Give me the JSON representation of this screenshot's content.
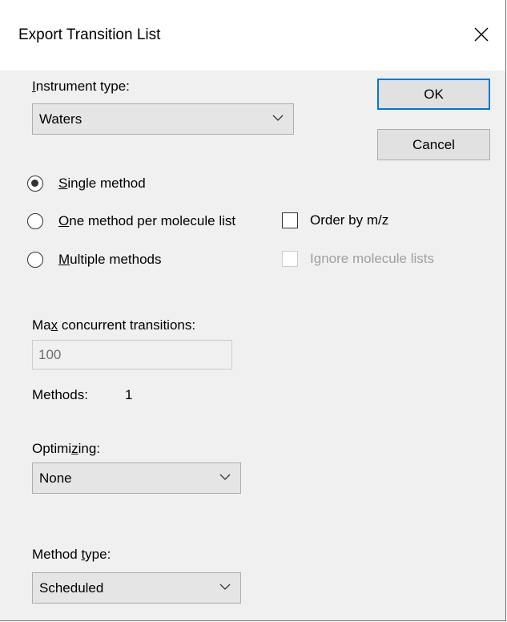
{
  "window": {
    "title": "Export Transition List",
    "close_icon": "close-x-icon"
  },
  "instrument": {
    "label_u": "I",
    "label_rest": "nstrument type:",
    "value": "Waters"
  },
  "buttons": {
    "ok": "OK",
    "cancel": "Cancel"
  },
  "methods": {
    "single": {
      "u": "S",
      "rest": "ingle method",
      "checked": true
    },
    "per_list": {
      "u": "O",
      "rest": "ne method per molecule list",
      "checked": false
    },
    "multiple": {
      "u": "M",
      "rest": "ultiple methods",
      "checked": false
    }
  },
  "order_by_mz": {
    "label": "Order by m/z",
    "checked": false
  },
  "ignore_lists": {
    "pre": "I",
    "u": "g",
    "rest": "nore molecule lists",
    "checked": false,
    "enabled": false
  },
  "max_concurrent": {
    "pre": "Ma",
    "u": "x",
    "rest": " concurrent transitions:",
    "value": "100"
  },
  "methods_count": {
    "label": "Methods:",
    "value": "1"
  },
  "optimizing": {
    "pre": "Optimi",
    "u": "z",
    "rest": "ing:",
    "value": "None"
  },
  "method_type": {
    "pre": "Method ",
    "u": "t",
    "rest": "ype:",
    "value": "Scheduled"
  },
  "colors": {
    "accent": "#0078d7",
    "dialog_bg": "#f0f0f0",
    "disabled_text": "#a0a0a0"
  }
}
